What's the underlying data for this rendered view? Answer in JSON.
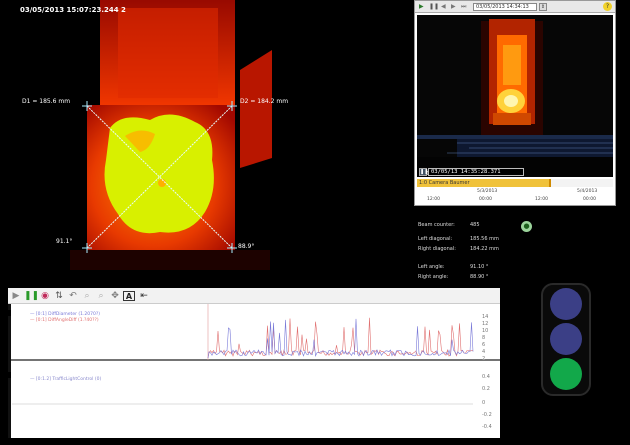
{
  "thermal_view": {
    "timestamp": "03/05/2013 15:07:23.244  2",
    "diagonal_1": "D1 = 185.6 mm",
    "diagonal_2": "D2 = 184.2 mm",
    "angle_left": "91.1°",
    "angle_right": "88.9°"
  },
  "camera_panel": {
    "date_field": "03/05/2013 14:34:13",
    "camera_name": "[1:0] Camera Baumer",
    "time_value": "03/05/13 14:35:28.371",
    "timeline": {
      "track_label": "1:0 Camera Baumer",
      "dates": [
        "5/3/2013",
        "5/4/2013"
      ],
      "times": [
        "12:00",
        "00:00",
        "12:00",
        "00:00"
      ]
    }
  },
  "stats": {
    "beam_counter_label": "Beam counter:",
    "beam_counter_value": "485",
    "left_diagonal_label": "Left diagonal:",
    "left_diagonal_value": "185.56 mm",
    "right_diagonal_label": "Right diagonal:",
    "right_diagonal_value": "184.22 mm",
    "left_angle_label": "Left angle:",
    "left_angle_value": "91.10 °",
    "right_angle_label": "Right angle:",
    "right_angle_value": "88.90 °"
  },
  "trend": {
    "legend_1": "— [0:1] DiffDiameter (1.2070?)",
    "legend_2": "— [0:1] DiffAngleDiff (1.?40??)",
    "legend_3": "— [0:1.2] TrafficLightControl (0)",
    "y_ticks_upper": [
      "14",
      "12",
      "10",
      "8",
      "6",
      "4",
      "2"
    ],
    "y_ticks_lower": [
      "0.4",
      "0.2",
      "0",
      "-0.2",
      "-0.4"
    ],
    "series_colors": {
      "diameter": "#7a7ad8",
      "angle": "#e07070"
    }
  },
  "traffic_light": {
    "state": "green",
    "colors": {
      "off": "#3b3f86",
      "green": "#12a84a"
    }
  }
}
